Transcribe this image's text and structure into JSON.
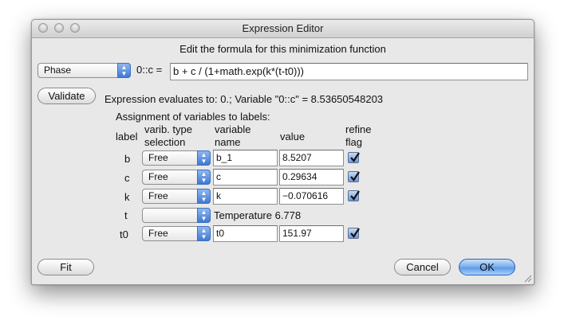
{
  "window": {
    "title": "Expression Editor"
  },
  "header": {
    "instruction": "Edit the formula for this minimization function"
  },
  "formula": {
    "type_select": "Phase",
    "label": "0::c =",
    "expression": "b + c / (1+math.exp(k*(t-t0)))"
  },
  "validate": {
    "button": "Validate",
    "result": "Expression evaluates to: 0.; Variable \"0::c\" = 8.53650548203"
  },
  "assignment": {
    "heading": "Assignment of variables to labels:",
    "col_label": "label",
    "col_type_1": "varib. type",
    "col_type_2": "selection",
    "col_name_1": "variable",
    "col_name_2": "name",
    "col_value": "value",
    "col_refine_1": "refine",
    "col_refine_2": "flag",
    "rows": [
      {
        "label": "b",
        "type": "Free",
        "name": "b_1",
        "value": "8.5207",
        "refine": true
      },
      {
        "label": "c",
        "type": "Free",
        "name": "c",
        "value": "0.29634",
        "refine": true
      },
      {
        "label": "k",
        "type": "Free",
        "name": "k",
        "value": "−0.070616",
        "refine": true
      },
      {
        "label": "t",
        "type": "",
        "static_text": "Temperature 6.778"
      },
      {
        "label": "t0",
        "type": "Free",
        "name": "t0",
        "value": "151.97",
        "refine": true
      }
    ]
  },
  "footer": {
    "fit": "Fit",
    "cancel": "Cancel",
    "ok": "OK"
  }
}
